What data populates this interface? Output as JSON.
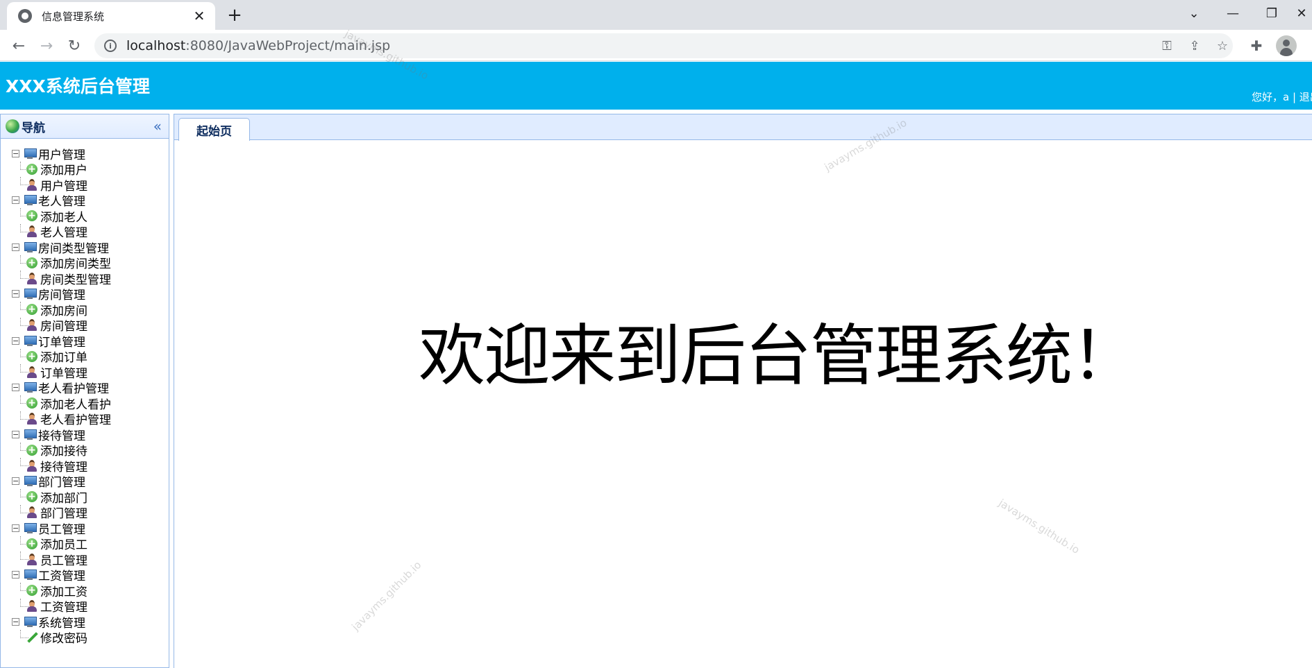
{
  "browser": {
    "tab_title": "信息管理系统",
    "tab_close": "✕",
    "new_tab": "+",
    "url_host": "localhost",
    "url_path": ":8080/JavaWebProject/main.jsp"
  },
  "header": {
    "title": "XXX系统后台管理",
    "greeting": "您好，a | 退出"
  },
  "nav": {
    "title": "导航",
    "collapse": "«",
    "groups": [
      {
        "label": "用户管理",
        "items": [
          {
            "label": "添加用户",
            "icon": "add-icon"
          },
          {
            "label": "用户管理",
            "icon": "user-icon"
          }
        ]
      },
      {
        "label": "老人管理",
        "items": [
          {
            "label": "添加老人",
            "icon": "add-icon"
          },
          {
            "label": "老人管理",
            "icon": "user-icon"
          }
        ]
      },
      {
        "label": "房间类型管理",
        "items": [
          {
            "label": "添加房间类型",
            "icon": "add-icon"
          },
          {
            "label": "房间类型管理",
            "icon": "user-icon"
          }
        ]
      },
      {
        "label": "房间管理",
        "items": [
          {
            "label": "添加房间",
            "icon": "add-icon"
          },
          {
            "label": "房间管理",
            "icon": "user-icon"
          }
        ]
      },
      {
        "label": "订单管理",
        "items": [
          {
            "label": "添加订单",
            "icon": "add-icon"
          },
          {
            "label": "订单管理",
            "icon": "user-icon"
          }
        ]
      },
      {
        "label": "老人看护管理",
        "items": [
          {
            "label": "添加老人看护",
            "icon": "add-icon"
          },
          {
            "label": "老人看护管理",
            "icon": "user-icon"
          }
        ]
      },
      {
        "label": "接待管理",
        "items": [
          {
            "label": "添加接待",
            "icon": "add-icon"
          },
          {
            "label": "接待管理",
            "icon": "user-icon"
          }
        ]
      },
      {
        "label": "部门管理",
        "items": [
          {
            "label": "添加部门",
            "icon": "add-icon"
          },
          {
            "label": "部门管理",
            "icon": "user-icon"
          }
        ]
      },
      {
        "label": "员工管理",
        "items": [
          {
            "label": "添加员工",
            "icon": "add-icon"
          },
          {
            "label": "员工管理",
            "icon": "user-icon"
          }
        ]
      },
      {
        "label": "工资管理",
        "items": [
          {
            "label": "添加工资",
            "icon": "add-icon"
          },
          {
            "label": "工资管理",
            "icon": "user-icon"
          }
        ]
      },
      {
        "label": "系统管理",
        "items": [
          {
            "label": "修改密码",
            "icon": "pencil-icon"
          }
        ]
      }
    ]
  },
  "main": {
    "tab_label": "起始页",
    "welcome": "欢迎来到后台管理系统！"
  },
  "watermark": "javayms.github.io",
  "colors": {
    "header_bg": "#00b0ec",
    "panel_border": "#95b8e7",
    "tabbar_bg": "#e0ecff"
  }
}
